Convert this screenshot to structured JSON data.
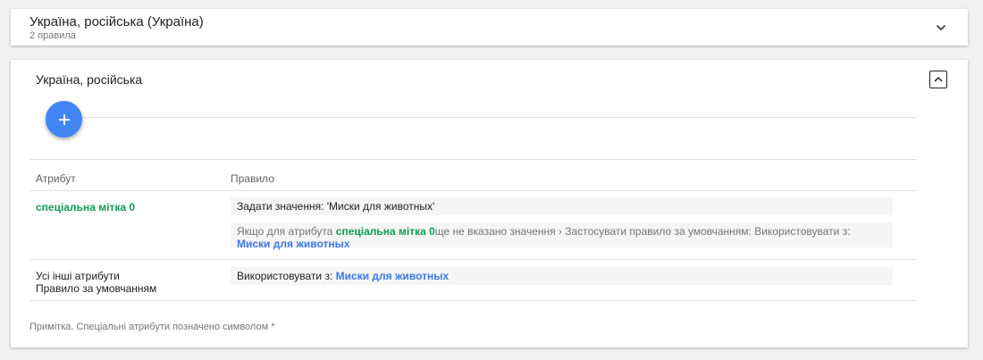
{
  "collapsed_card": {
    "title": "Україна, російська (Україна)",
    "subtitle": "2 правила"
  },
  "expanded_card": {
    "title": "Україна, російська",
    "table": {
      "headers": {
        "attribute": "Атрибут",
        "rule": "Правило"
      },
      "rows": [
        {
          "attribute": "спеціальна мітка 0",
          "rule_main": "Задати значення: 'Миски для животных'",
          "rule_note_prefix": "Якщо для атрибута ",
          "rule_note_attr": "спеціальна мітка 0",
          "rule_note_middle": "ще не вказано значення › Застосувати правило за умовчанням: Використовувати з: ",
          "rule_note_link": "Миски для животных"
        },
        {
          "attribute_line1": "Усі інші атрибути",
          "attribute_line2": "Правило за умовчанням",
          "rule_prefix": "Використовувати з: ",
          "rule_link": "Миски для животных"
        }
      ]
    },
    "footnote": "Примітка. Спеціальні атрибути позначено символом *"
  },
  "colors": {
    "accent_blue": "#4285f4",
    "link_blue": "#3b78e7",
    "special_green": "#0f9d58"
  },
  "icons": {
    "collapsed_toggle": "chevron-down-icon",
    "expanded_toggle": "chevron-up-icon",
    "fab": "plus-icon"
  }
}
